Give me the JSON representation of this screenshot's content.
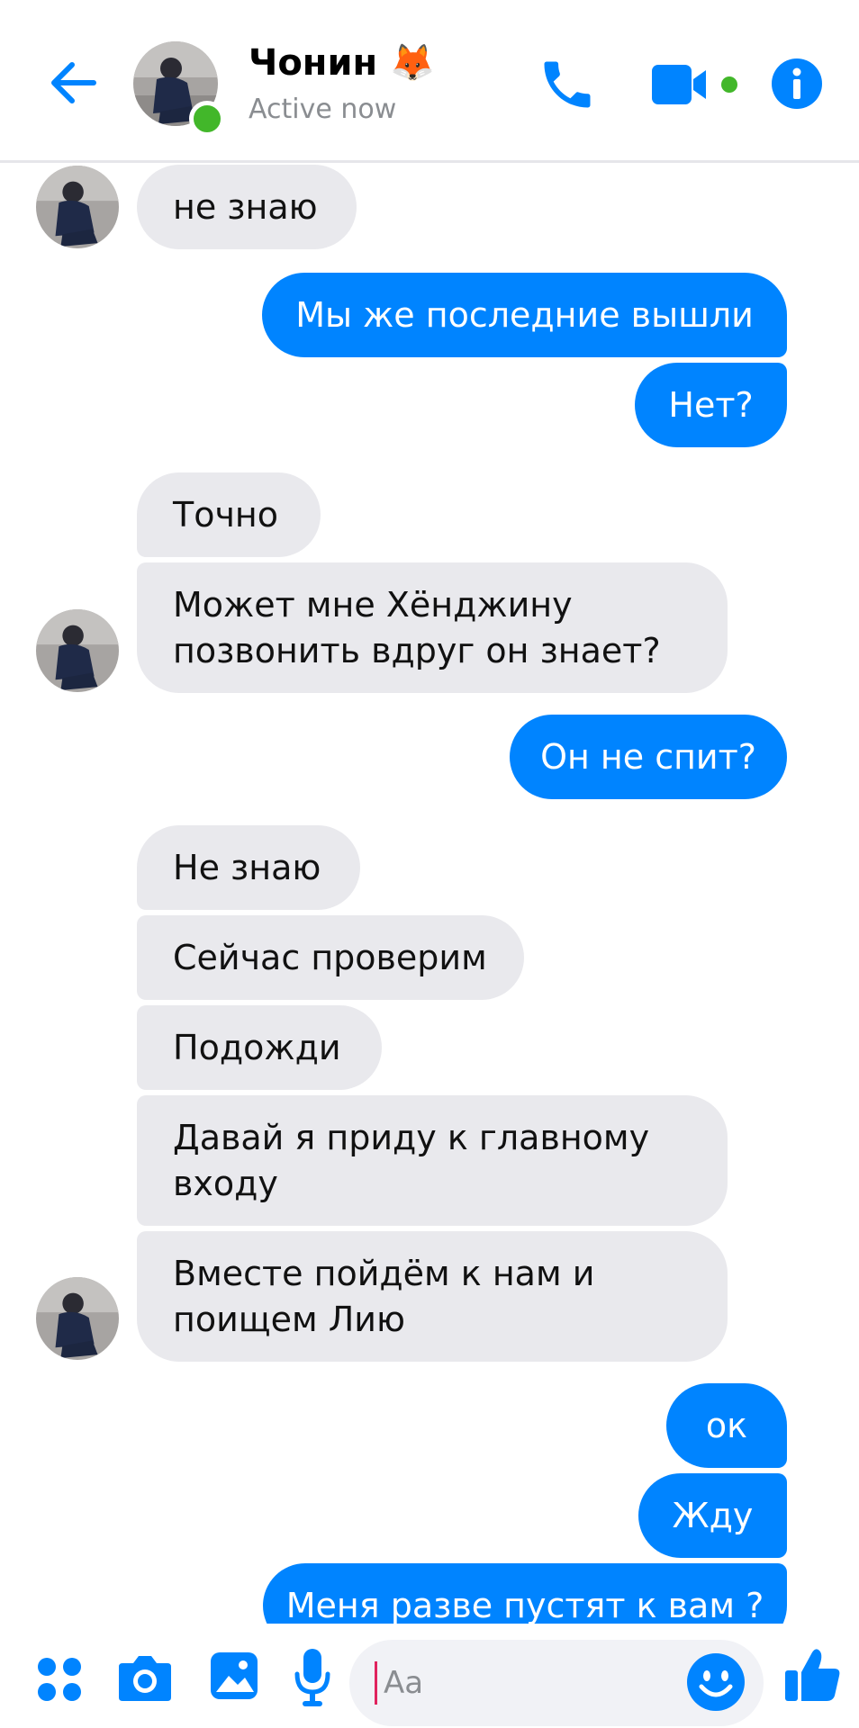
{
  "header": {
    "back_icon": "arrow-left-icon",
    "contact_name": "Чонин 🦊",
    "status": "Active now",
    "call_icon": "phone-icon",
    "video_icon": "video-camera-icon",
    "info_icon": "info-icon",
    "accent_color": "#0084ff",
    "presence_color": "#42b72a"
  },
  "messages": [
    {
      "side": "in",
      "text": "не знаю"
    },
    {
      "side": "out",
      "text": "Мы же последние вышли"
    },
    {
      "side": "out",
      "text": "Нет?"
    },
    {
      "side": "in",
      "text": "Точно"
    },
    {
      "side": "in",
      "lines": [
        "Может мне Хёнджину",
        "позвонить вдруг он знает?"
      ]
    },
    {
      "side": "out",
      "text": "Он не спит?"
    },
    {
      "side": "in",
      "text": "Не знаю"
    },
    {
      "side": "in",
      "text": "Сейчас проверим"
    },
    {
      "side": "in",
      "text": "Подожди"
    },
    {
      "side": "in",
      "lines": [
        "Давай я приду к главному",
        "входу"
      ]
    },
    {
      "side": "in",
      "lines": [
        "Вместе пойдём к нам и",
        "поищем Лию"
      ]
    },
    {
      "side": "out",
      "text": "ок"
    },
    {
      "side": "out",
      "text": "Жду"
    },
    {
      "side": "out",
      "text": "Меня разве пустят к вам ?"
    }
  ],
  "composer": {
    "placeholder": "Aa",
    "icons": [
      "grid-menu-icon",
      "camera-icon",
      "gallery-icon",
      "microphone-icon",
      "emoji-icon",
      "thumbs-up-icon"
    ]
  }
}
